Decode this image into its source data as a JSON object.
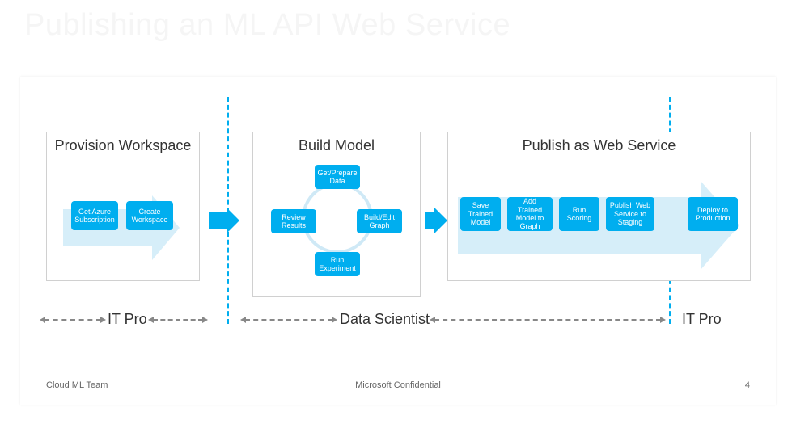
{
  "title": "Publishing an ML API Web Service",
  "panels": {
    "provision": {
      "title": "Provision Workspace",
      "steps": [
        "Get  Azure Subscription",
        "Create Workspace"
      ]
    },
    "build": {
      "title": "Build Model",
      "steps": [
        "Get/Prepare Data",
        "Build/Edit Graph",
        "Run Experiment",
        "Review Results"
      ]
    },
    "publish": {
      "title": "Publish as Web Service",
      "steps": [
        "Save Trained Model",
        "Add Trained Model to Graph",
        "Run Scoring",
        "Publish Web Service to Staging",
        "Deploy to Production"
      ]
    }
  },
  "roles": {
    "left": "IT Pro",
    "center": "Data Scientist",
    "right": "IT Pro"
  },
  "footer": {
    "left": "Cloud ML Team",
    "center": "Microsoft Confidential",
    "page": "4"
  },
  "colors": {
    "accent": "#00AEEF",
    "arrow_light": "#d6eef9"
  }
}
